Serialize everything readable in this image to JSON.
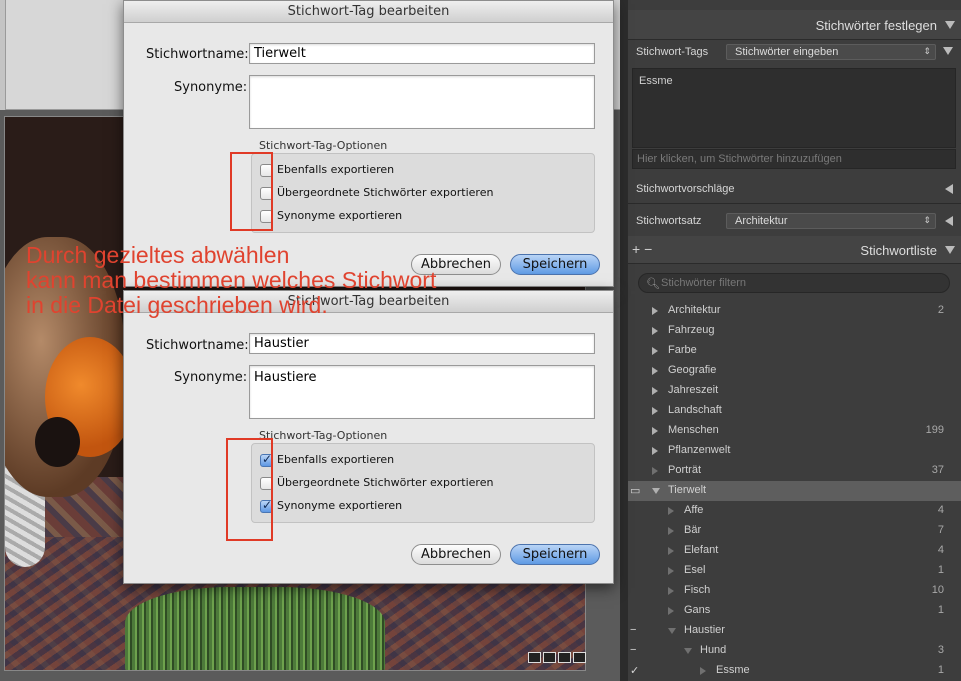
{
  "dialogs": [
    {
      "title": "Stichwort-Tag bearbeiten",
      "name_label": "Stichwortname:",
      "name_value": "Tierwelt",
      "synonyms_label": "Synonyme:",
      "synonyms_value": "",
      "options_title": "Stichwort-Tag-Optionen",
      "options": [
        {
          "label": "Ebenfalls exportieren",
          "checked": false
        },
        {
          "label": "Übergeordnete Stichwörter exportieren",
          "checked": false
        },
        {
          "label": "Synonyme exportieren",
          "checked": false
        }
      ],
      "cancel_label": "Abbrechen",
      "save_label": "Speichern"
    },
    {
      "title": "Stichwort-Tag bearbeiten",
      "name_label": "Stichwortname:",
      "name_value": "Haustier",
      "synonyms_label": "Synonyme:",
      "synonyms_value": "Haustiere",
      "options_title": "Stichwort-Tag-Optionen",
      "options": [
        {
          "label": "Ebenfalls exportieren",
          "checked": true
        },
        {
          "label": "Übergeordnete Stichwörter exportieren",
          "checked": false
        },
        {
          "label": "Synonyme exportieren",
          "checked": true
        }
      ],
      "cancel_label": "Abbrechen",
      "save_label": "Speichern"
    }
  ],
  "annotation": {
    "lines": [
      "Durch gezieltes abwählen",
      "kann man bestimmen welches Stichwort",
      "in die Datei geschrieben wird."
    ],
    "color": "#e0432f"
  },
  "right_panel": {
    "keyword_section_title": "Stichwörter festlegen",
    "tags_label": "Stichwort-Tags",
    "tags_mode": "Stichwörter eingeben",
    "current_keywords": "Essme",
    "add_hint": "Hier klicken, um Stichwörter hinzuzufügen",
    "suggestions_title": "Stichwortvorschläge",
    "set_label": "Stichwortsatz",
    "set_value": "Architektur",
    "list_title": "Stichwortliste",
    "plus_minus": "+ −",
    "filter_placeholder": "Stichwörter filtern",
    "keywords": [
      {
        "label": "Architektur",
        "count": "2",
        "level": 0,
        "expand": "right",
        "mark": ""
      },
      {
        "label": "Fahrzeug",
        "count": "",
        "level": 0,
        "expand": "right",
        "mark": ""
      },
      {
        "label": "Farbe",
        "count": "",
        "level": 0,
        "expand": "right",
        "mark": ""
      },
      {
        "label": "Geografie",
        "count": "",
        "level": 0,
        "expand": "right",
        "mark": ""
      },
      {
        "label": "Jahreszeit",
        "count": "",
        "level": 0,
        "expand": "right",
        "mark": ""
      },
      {
        "label": "Landschaft",
        "count": "",
        "level": 0,
        "expand": "right",
        "mark": ""
      },
      {
        "label": "Menschen",
        "count": "199",
        "level": 0,
        "expand": "right",
        "mark": ""
      },
      {
        "label": "Pflanzenwelt",
        "count": "",
        "level": 0,
        "expand": "right",
        "mark": ""
      },
      {
        "label": "Porträt",
        "count": "37",
        "level": 0,
        "expand": "dim",
        "mark": ""
      },
      {
        "label": "Tierwelt",
        "count": "",
        "level": 0,
        "expand": "down",
        "mark": "▭",
        "selected": true
      },
      {
        "label": "Affe",
        "count": "4",
        "level": 1,
        "expand": "dim",
        "mark": ""
      },
      {
        "label": "Bär",
        "count": "7",
        "level": 1,
        "expand": "dim",
        "mark": ""
      },
      {
        "label": "Elefant",
        "count": "4",
        "level": 1,
        "expand": "dim",
        "mark": ""
      },
      {
        "label": "Esel",
        "count": "1",
        "level": 1,
        "expand": "dim",
        "mark": ""
      },
      {
        "label": "Fisch",
        "count": "10",
        "level": 1,
        "expand": "dim",
        "mark": ""
      },
      {
        "label": "Gans",
        "count": "1",
        "level": 1,
        "expand": "dim",
        "mark": ""
      },
      {
        "label": "Haustier",
        "count": "",
        "level": 1,
        "expand": "downdim",
        "mark": "−"
      },
      {
        "label": "Hund",
        "count": "3",
        "level": 2,
        "expand": "downdim",
        "mark": "−"
      },
      {
        "label": "Essme",
        "count": "1",
        "level": 3,
        "expand": "dim",
        "mark": "✓"
      }
    ]
  }
}
